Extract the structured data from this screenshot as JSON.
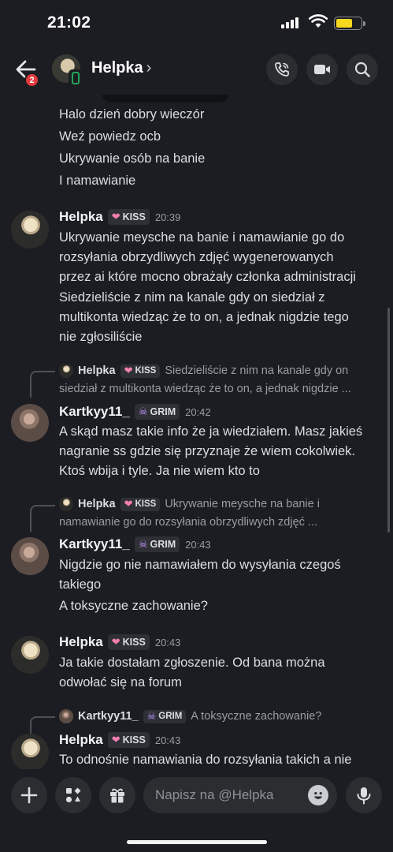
{
  "status_bar": {
    "time": "21:02"
  },
  "header": {
    "back_badge": "2",
    "name": "Helpka",
    "chevron": "›"
  },
  "colors": {
    "background": "#1c1d22",
    "online": "#23a55a",
    "badge": "#e5393d",
    "kiss_heart": "#f47fb0",
    "grim_skull": "#b993f5"
  },
  "messages": {
    "m0": {
      "lines": [
        "Halo dzień dobry wieczór",
        "Weź powiedz ocb",
        "Ukrywanie osób na banie",
        "I namawianie"
      ]
    },
    "m1": {
      "author": "Helpka",
      "tag": "KISS",
      "time": "20:39",
      "lines": [
        "Ukrywanie meysche na banie i namawianie go do",
        "rozsyłania obrzydliwych zdjęć wygenerowanych",
        "przez ai które mocno obrażały członka administracji",
        "Siedzieliście z nim na kanale gdy on siedział z",
        "multikonta wiedząc że to on, a jednak nigdzie tego",
        "nie zgłosiliście"
      ]
    },
    "m2": {
      "reply": {
        "author": "Helpka",
        "tag": "KISS",
        "text1": "Siedzieliście z nim na kanale gdy on",
        "text2": "siedział z multikonta wiedząc że to on, a jednak nigdzie ..."
      },
      "author": "Kartkyy11_",
      "tag": "GRIM",
      "time": "20:42",
      "lines": [
        "A skąd masz takie info że ja wiedziałem. Masz jakieś",
        "nagranie ss gdzie się przyznaje że wiem cokolwiek.",
        "Ktoś wbija i tyle. Ja nie wiem kto to"
      ]
    },
    "m3": {
      "reply": {
        "author": "Helpka",
        "tag": "KISS",
        "text1": "Ukrywanie meysche na banie i",
        "text2": "namawianie go do rozsyłania obrzydliwych zdjęć ..."
      },
      "author": "Kartkyy11_",
      "tag": "GRIM",
      "time": "20:43",
      "lines": [
        "Nigdzie go nie namawiałem do wysyłania czegoś",
        "takiego",
        "A toksyczne zachowanie?"
      ]
    },
    "m4": {
      "author": "Helpka",
      "tag": "KISS",
      "time": "20:43",
      "lines": [
        "Ja takie dostałam zgłoszenie. Od bana można",
        "odwołać się na forum"
      ]
    },
    "m5": {
      "reply": {
        "author": "Kartkyy11_",
        "tag": "GRIM",
        "text1": "A toksyczne zachowanie?"
      },
      "author": "Helpka",
      "tag": "KISS",
      "time": "20:43",
      "lines": [
        "To odnośnie namawiania do rozsyłania takich a nie"
      ]
    }
  },
  "composer": {
    "placeholder": "Napisz na @Helpka"
  },
  "icons": [
    "back-arrow-icon",
    "device-icon",
    "phone-call-icon",
    "video-call-icon",
    "search-icon",
    "plus-icon",
    "apps-icon",
    "gift-icon",
    "emoji-icon",
    "microphone-icon"
  ]
}
